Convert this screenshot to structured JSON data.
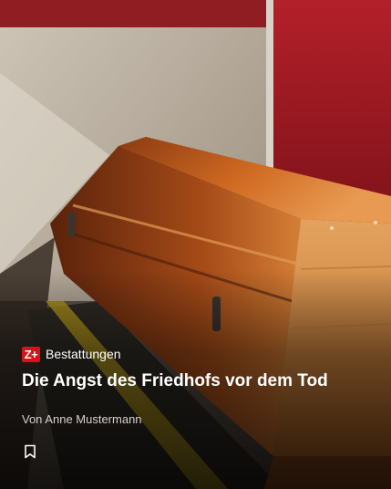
{
  "teaser": {
    "badge": "Z+",
    "category": "Bestattungen",
    "title": "Die Angst des Friedhofs vor dem Tod",
    "author": "Von Anne Mustermann"
  },
  "icons": {
    "bookmark": "bookmark-icon"
  },
  "colors": {
    "badge_bg": "#d6131d",
    "text": "#ffffff",
    "author": "#d8d2cc"
  }
}
